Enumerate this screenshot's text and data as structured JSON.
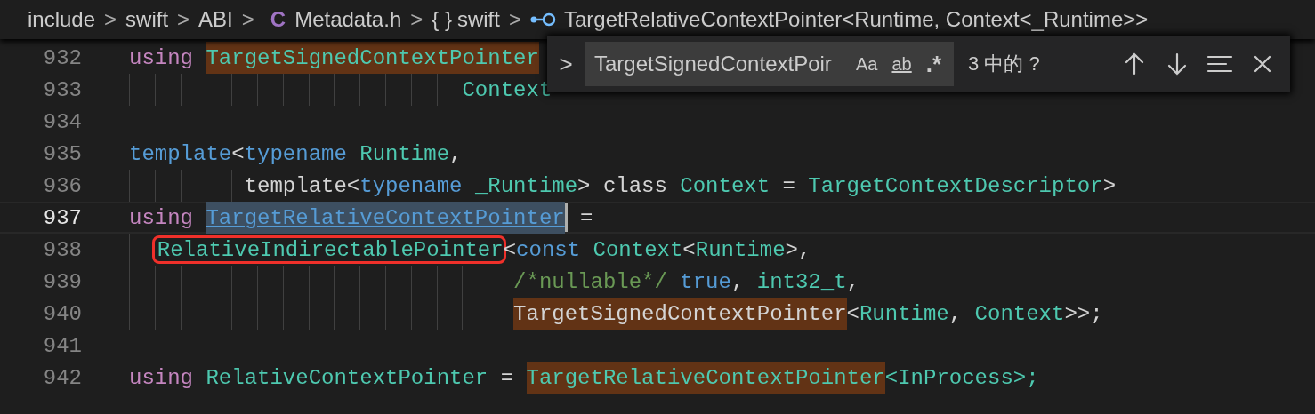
{
  "breadcrumb": [
    {
      "kind": "folder",
      "label": "include"
    },
    {
      "kind": "folder",
      "label": "swift"
    },
    {
      "kind": "folder",
      "label": "ABI"
    },
    {
      "kind": "file",
      "icon": "C",
      "label": "Metadata.h"
    },
    {
      "kind": "namespace",
      "icon": "{ }",
      "label": "swift"
    },
    {
      "kind": "symbol",
      "label": "TargetRelativeContextPointer<Runtime, Context<_Runtime>>"
    }
  ],
  "separator": ">",
  "lines": [
    {
      "number": "932",
      "current": false,
      "tokens": [
        {
          "text": "using ",
          "kind": "keyword"
        },
        {
          "text": "TargetSignedContextPointer",
          "kind": "type",
          "matched": true
        }
      ]
    },
    {
      "number": "933",
      "current": false,
      "tokens": [
        {
          "text": "                          Context",
          "kind": "type"
        }
      ]
    },
    {
      "number": "934",
      "current": false
    },
    {
      "number": "935",
      "current": false,
      "tokens": [
        {
          "text": "template",
          "kind": "storage"
        },
        {
          "text": "<",
          "kind": "plain"
        },
        {
          "text": "typename ",
          "kind": "storage"
        },
        {
          "text": "Runtime",
          "kind": "type"
        },
        {
          "text": ",",
          "kind": "plain"
        }
      ]
    },
    {
      "number": "936",
      "current": false,
      "tokens": [
        {
          "text": "         template<",
          "kind": "plain"
        },
        {
          "text": "typename ",
          "kind": "storage"
        },
        {
          "text": "_Runtime",
          "kind": "type"
        },
        {
          "text": "> class ",
          "kind": "plain"
        },
        {
          "text": "Context",
          "kind": "type"
        },
        {
          "text": " = ",
          "kind": "plain"
        },
        {
          "text": "TargetContextDescriptor",
          "kind": "type"
        },
        {
          "text": ">",
          "kind": "plain"
        }
      ]
    },
    {
      "number": "937",
      "current": true,
      "tokens": [
        {
          "text": "using ",
          "kind": "keyword"
        },
        {
          "text": "TargetRelativeContextPointer",
          "kind": "link",
          "selection": true,
          "cursor_after": true
        },
        {
          "text": " =",
          "kind": "plain"
        }
      ]
    },
    {
      "number": "938",
      "current": false,
      "tokens": [
        {
          "text": "  RelativeIndirectablePointer",
          "kind": "type",
          "boxed": true
        },
        {
          "text": "<",
          "kind": "plain"
        },
        {
          "text": "const ",
          "kind": "storage"
        },
        {
          "text": "Context",
          "kind": "type"
        },
        {
          "text": "<",
          "kind": "plain"
        },
        {
          "text": "Runtime",
          "kind": "type"
        },
        {
          "text": ">,",
          "kind": "plain"
        }
      ]
    },
    {
      "number": "939",
      "current": false,
      "tokens": [
        {
          "text": "                              /*nullable*/ ",
          "kind": "comment"
        },
        {
          "text": "true",
          "kind": "storage"
        },
        {
          "text": ", ",
          "kind": "plain"
        },
        {
          "text": "int32_t",
          "kind": "type"
        },
        {
          "text": ",",
          "kind": "plain"
        }
      ]
    },
    {
      "number": "940",
      "current": false,
      "tokens": [
        {
          "text": "                              TargetSignedContextPointer",
          "kind": "plain",
          "matched": true
        },
        {
          "text": "<",
          "kind": "plain"
        },
        {
          "text": "Runtime",
          "kind": "type"
        },
        {
          "text": ", ",
          "kind": "plain"
        },
        {
          "text": "Context",
          "kind": "type"
        },
        {
          "text": ">>;",
          "kind": "plain"
        }
      ]
    },
    {
      "number": "941",
      "current": false
    },
    {
      "number": "942",
      "current": false,
      "tokens": [
        {
          "text": "using ",
          "kind": "keyword"
        },
        {
          "text": "RelativeContextPointer",
          "kind": "type"
        },
        {
          "text": " = ",
          "kind": "plain"
        },
        {
          "text": "TargetRelativeContextPointer",
          "kind": "type",
          "matched": true
        },
        {
          "text": "<InProcess>;",
          "kind": "type"
        }
      ]
    }
  ],
  "find_widget": {
    "toggle": ">",
    "value": "TargetSignedContextPoir",
    "options": [
      {
        "kind": "case",
        "label": "Aa",
        "on": false
      },
      {
        "kind": "word",
        "label": "ab",
        "on": false
      },
      {
        "kind": "regex",
        "label": ".*",
        "on": false
      }
    ],
    "status": "3 中的 ?"
  }
}
